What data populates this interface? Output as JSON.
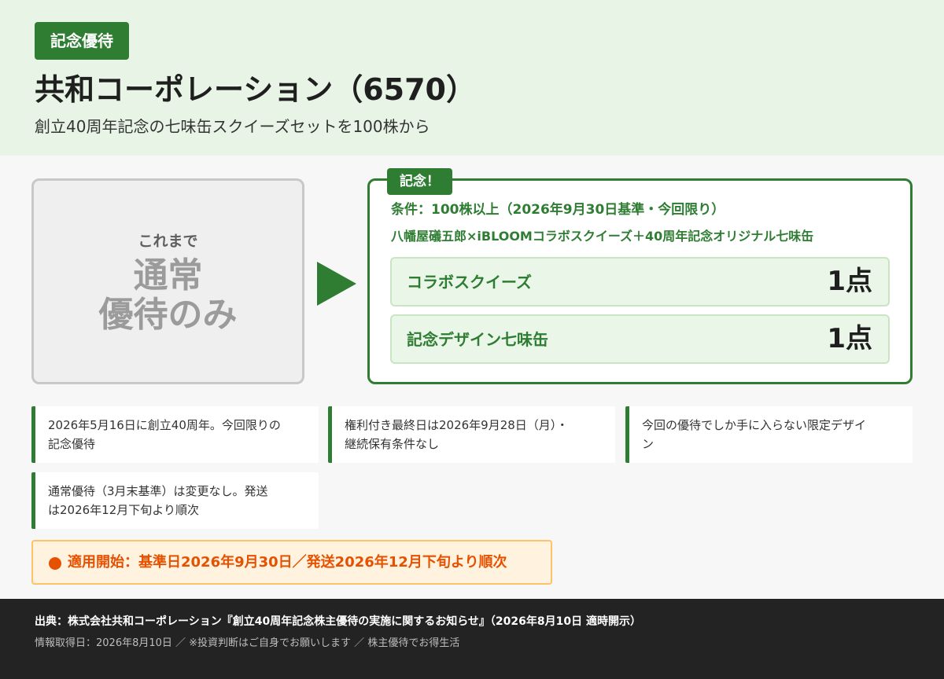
{
  "header": {
    "badge": "記念優待",
    "title": "共和コーポレーション（6570）",
    "subtitle": "創立40周年記念の七味缶スクイーズセットを100株から"
  },
  "before": {
    "label": "これまで",
    "main_line1": "通常",
    "main_line2": "優待のみ"
  },
  "after": {
    "tag": "記念！",
    "condition": "条件：100株以上（2026年9月30日基準・今回限り）",
    "description": "八幡屋礒五郎×iBLOOMコラボスクイーズ＋40周年記念オリジナル七味缶",
    "items": [
      {
        "label": "コラボスクイーズ",
        "count": "1点"
      },
      {
        "label": "記念デザイン七味缶",
        "count": "1点"
      }
    ]
  },
  "notes": [
    {
      "line1": "2026年5月16日に創立40周年。今回限りの",
      "line2": "記念優待"
    },
    {
      "line1": "権利付き最終日は2026年9月28日（月）・",
      "line2": "継続保有条件なし"
    },
    {
      "line1": "今回の優待でしか手に入らない限定デザイ",
      "line2": "ン"
    },
    {
      "line1": "通常優待（3月末基準）は変更なし。発送",
      "line2": "は2026年12月下旬より順次"
    }
  ],
  "start": {
    "text": "適用開始：基準日2026年9月30日／発送2026年12月下旬より順次"
  },
  "footer": {
    "source": "出典：株式会社共和コーポレーション『創立40周年記念株主優待の実施に関するお知らせ』（2026年8月10日 適時開示）",
    "meta": "情報取得日：2026年8月10日 ／ ※投資判断はご自身でお願いします ／ 株主優待でお得生活"
  },
  "colors": {
    "accent_green": "#2e7d32",
    "header_bg": "#e8f5e6",
    "orange": "#e65100",
    "footer_bg": "#232323"
  }
}
